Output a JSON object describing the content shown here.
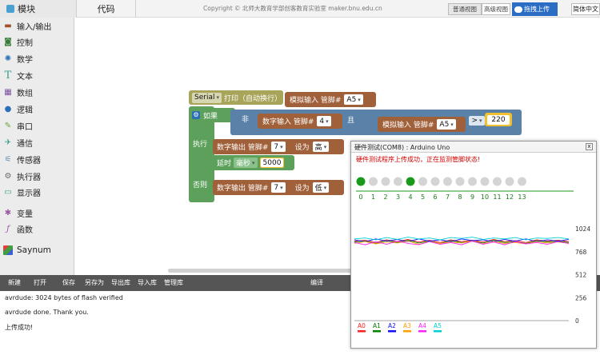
{
  "topbar": {
    "blocks_tab": "模块",
    "code_tab": "代码",
    "copyright": "Copyright © 北师大教育学部创客教育实验室 maker.bnu.edu.cn",
    "normal_view": "普通视图",
    "advanced_view": "高级视图",
    "upload": "拖拽上传",
    "language": "简体中文"
  },
  "sidebar": {
    "items": [
      {
        "label": "输入/输出",
        "icon": "io-icon",
        "color": "#a0522d"
      },
      {
        "label": "控制",
        "icon": "gamepad-icon",
        "color": "#3a7d3a"
      },
      {
        "label": "数学",
        "icon": "atom-icon",
        "color": "#2a6fb8"
      },
      {
        "label": "文本",
        "icon": "text-icon",
        "color": "#3a9a8a"
      },
      {
        "label": "数组",
        "icon": "array-icon",
        "color": "#7a4fa0"
      },
      {
        "label": "逻辑",
        "icon": "bulb-icon",
        "color": "#2a6fb8"
      },
      {
        "label": "串口",
        "icon": "pen-icon",
        "color": "#6aa040"
      },
      {
        "label": "通信",
        "icon": "satellite-icon",
        "color": "#3a9a8a"
      },
      {
        "label": "传感器",
        "icon": "sensor-icon",
        "color": "#5a8ab0"
      },
      {
        "label": "执行器",
        "icon": "motor-icon",
        "color": "#6a6a6a"
      },
      {
        "label": "显示器",
        "icon": "monitor-icon",
        "color": "#3a9a8a"
      },
      {
        "label": "变量",
        "icon": "variable-icon",
        "color": "#9a5aa0"
      },
      {
        "label": "函数",
        "icon": "function-icon",
        "color": "#9a5aa0"
      },
      {
        "label": "Saynum",
        "icon": "cube-icon",
        "color": "#d04040"
      }
    ]
  },
  "blocks": {
    "serial": "Serial",
    "print_newline": "打印（自动换行）",
    "analog_read": "模拟输入 管脚#",
    "analog_pin1": "A5",
    "if": "如果",
    "not": "非",
    "digital_read": "数字输入 管脚#",
    "digital_pin": "4",
    "and": "且",
    "analog_read2": "模拟输入 管脚#",
    "analog_pin2": "A5",
    "gt": ">",
    "threshold": "220",
    "do": "执行",
    "digital_write1": "数字输出 管脚#",
    "write_pin1": "7",
    "set_to1": "设为",
    "value_high": "高",
    "delay": "延时",
    "delay_unit": "毫秒",
    "delay_value": "5000",
    "else": "否则",
    "digital_write2": "数字输出 管脚#",
    "write_pin2": "7",
    "set_to2": "设为",
    "value_low": "低"
  },
  "bottombar": {
    "new": "新建",
    "open": "打开",
    "save": "保存",
    "save_as": "另存为",
    "export": "导出库",
    "import": "导入库",
    "manage": "管理库",
    "compile": "编译"
  },
  "console": {
    "line1": "avrdude: 3024 bytes of flash verified",
    "line2": "avrdude done.  Thank you.",
    "line3": "上传成功!"
  },
  "hardware": {
    "title": "硬件测试(COM8) : Arduino Uno",
    "close": "x",
    "status": "硬件测试程序上传成功，正在监测管脚状态!",
    "pins": [
      {
        "label": "0",
        "active": true
      },
      {
        "label": "1",
        "active": false
      },
      {
        "label": "2",
        "active": false
      },
      {
        "label": "3",
        "active": false
      },
      {
        "label": "4",
        "active": true
      },
      {
        "label": "5",
        "active": false
      },
      {
        "label": "6",
        "active": false
      },
      {
        "label": "7",
        "active": false
      },
      {
        "label": "8",
        "active": false
      },
      {
        "label": "9",
        "active": false
      },
      {
        "label": "10",
        "active": false
      },
      {
        "label": "11",
        "active": false
      },
      {
        "label": "12",
        "active": false
      },
      {
        "label": "13",
        "active": false
      }
    ],
    "active_color": "#1a9a1a",
    "inactive_color": "#d4d4d4"
  },
  "chart_data": {
    "type": "line",
    "ylim": [
      0,
      1024
    ],
    "yticks": [
      "1024",
      "768",
      "512",
      "256",
      "0"
    ],
    "x": [
      0,
      1,
      2,
      3,
      4,
      5,
      6,
      7,
      8,
      9,
      10,
      11,
      12,
      13,
      14,
      15,
      16,
      17,
      18,
      19,
      20
    ],
    "series": [
      {
        "name": "A0",
        "color": "#ff2020",
        "values": [
          885,
          895,
          870,
          900,
          880,
          905,
          875,
          895,
          870,
          900,
          880,
          895,
          875,
          905,
          880,
          890,
          870,
          900,
          885,
          895,
          880
        ]
      },
      {
        "name": "A1",
        "color": "#008000",
        "values": [
          875,
          885,
          860,
          890,
          870,
          895,
          865,
          885,
          860,
          890,
          870,
          885,
          865,
          895,
          870,
          880,
          860,
          890,
          875,
          885,
          870
        ]
      },
      {
        "name": "A2",
        "color": "#1010ff",
        "values": [
          900,
          880,
          910,
          885,
          905,
          880,
          910,
          885,
          900,
          880,
          910,
          890,
          900,
          880,
          905,
          885,
          910,
          880,
          900,
          885,
          905
        ]
      },
      {
        "name": "A3",
        "color": "#ffa000",
        "values": [
          860,
          880,
          855,
          875,
          865,
          885,
          850,
          880,
          860,
          875,
          865,
          885,
          855,
          880,
          860,
          870,
          855,
          880,
          865,
          875,
          860
        ]
      },
      {
        "name": "A4",
        "color": "#ff20ff",
        "values": [
          870,
          845,
          880,
          850,
          885,
          860,
          845,
          880,
          850,
          870,
          845,
          885,
          850,
          875,
          845,
          880,
          855,
          870,
          850,
          880,
          860
        ]
      },
      {
        "name": "A5",
        "color": "#00d0d0",
        "values": [
          910,
          920,
          900,
          925,
          905,
          930,
          910,
          920,
          900,
          925,
          915,
          930,
          905,
          920,
          910,
          925,
          900,
          920,
          915,
          925,
          910
        ]
      }
    ]
  }
}
